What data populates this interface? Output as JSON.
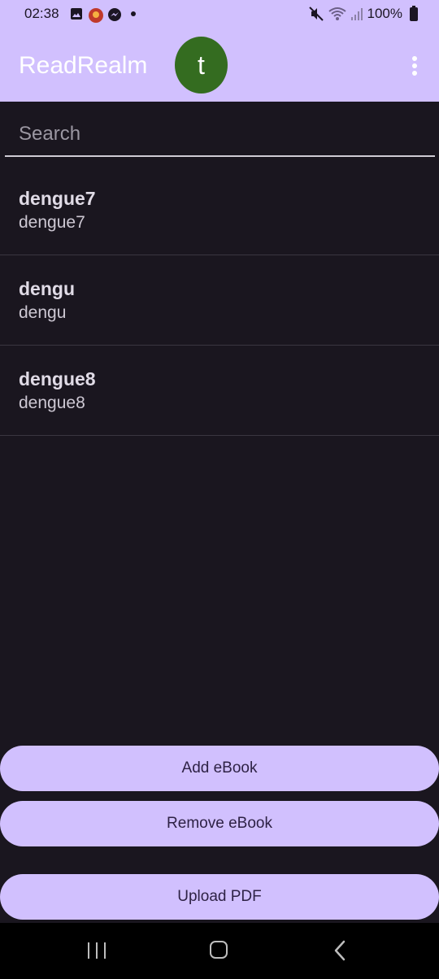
{
  "status_bar": {
    "time": "02:38",
    "battery": "100%",
    "icons": [
      "gallery-icon",
      "game-app-icon",
      "messenger-icon",
      "dot-icon",
      "mute-icon",
      "wifi-icon",
      "signal-icon",
      "battery-icon"
    ]
  },
  "app_bar": {
    "title": "ReadRealm",
    "avatar_letter": "t",
    "avatar_color": "#346c20",
    "accent_color": "#d1c0fe"
  },
  "search": {
    "placeholder": "Search",
    "value": ""
  },
  "books": [
    {
      "title": "dengue7",
      "subtitle": "dengue7"
    },
    {
      "title": "dengu",
      "subtitle": "dengu"
    },
    {
      "title": "dengue8",
      "subtitle": "dengue8"
    }
  ],
  "actions": {
    "add": "Add eBook",
    "remove": "Remove eBook",
    "upload": "Upload PDF"
  },
  "nav_bar": {
    "icons": [
      "recents-icon",
      "home-icon",
      "back-icon"
    ]
  }
}
